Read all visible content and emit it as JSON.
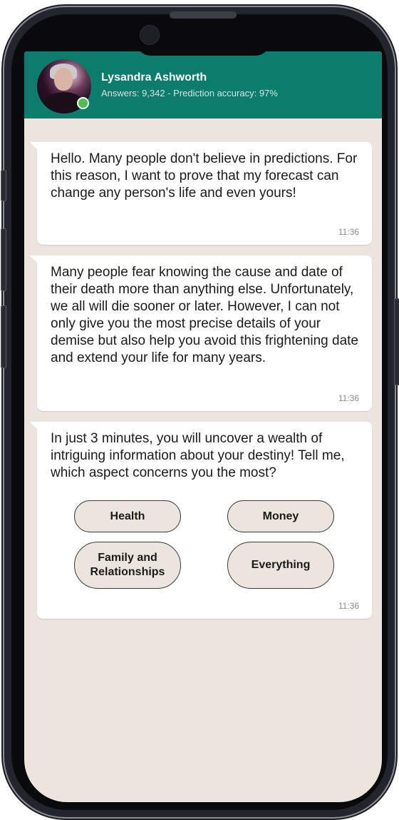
{
  "header": {
    "name": "Lysandra Ashworth",
    "status": "Answers: 9,342 - Prediction accuracy: 97%"
  },
  "messages": [
    {
      "text": "Hello. Many people don't believe in predictions. For this reason, I want to prove that my forecast can change any person's life and even yours!",
      "time": "11:36"
    },
    {
      "text": "Many people fear knowing the cause and date of their death more than anything else. Unfortunately, we all will die sooner or later. However, I can not only give you the most precise details of your demise but also help you avoid this frightening date and extend your life for many years.",
      "time": "11:36"
    },
    {
      "text": "In just 3 minutes, you will uncover a wealth of intriguing information about your destiny! Tell me, which aspect concerns you the most?",
      "time": "11:36",
      "options": [
        "Health",
        "Money",
        "Family and Relationships",
        "Everything"
      ]
    }
  ],
  "colors": {
    "header": "#0c7c6c",
    "chat_background": "#ece5dd",
    "bubble": "#ffffff",
    "online_indicator": "#4cc04a"
  }
}
